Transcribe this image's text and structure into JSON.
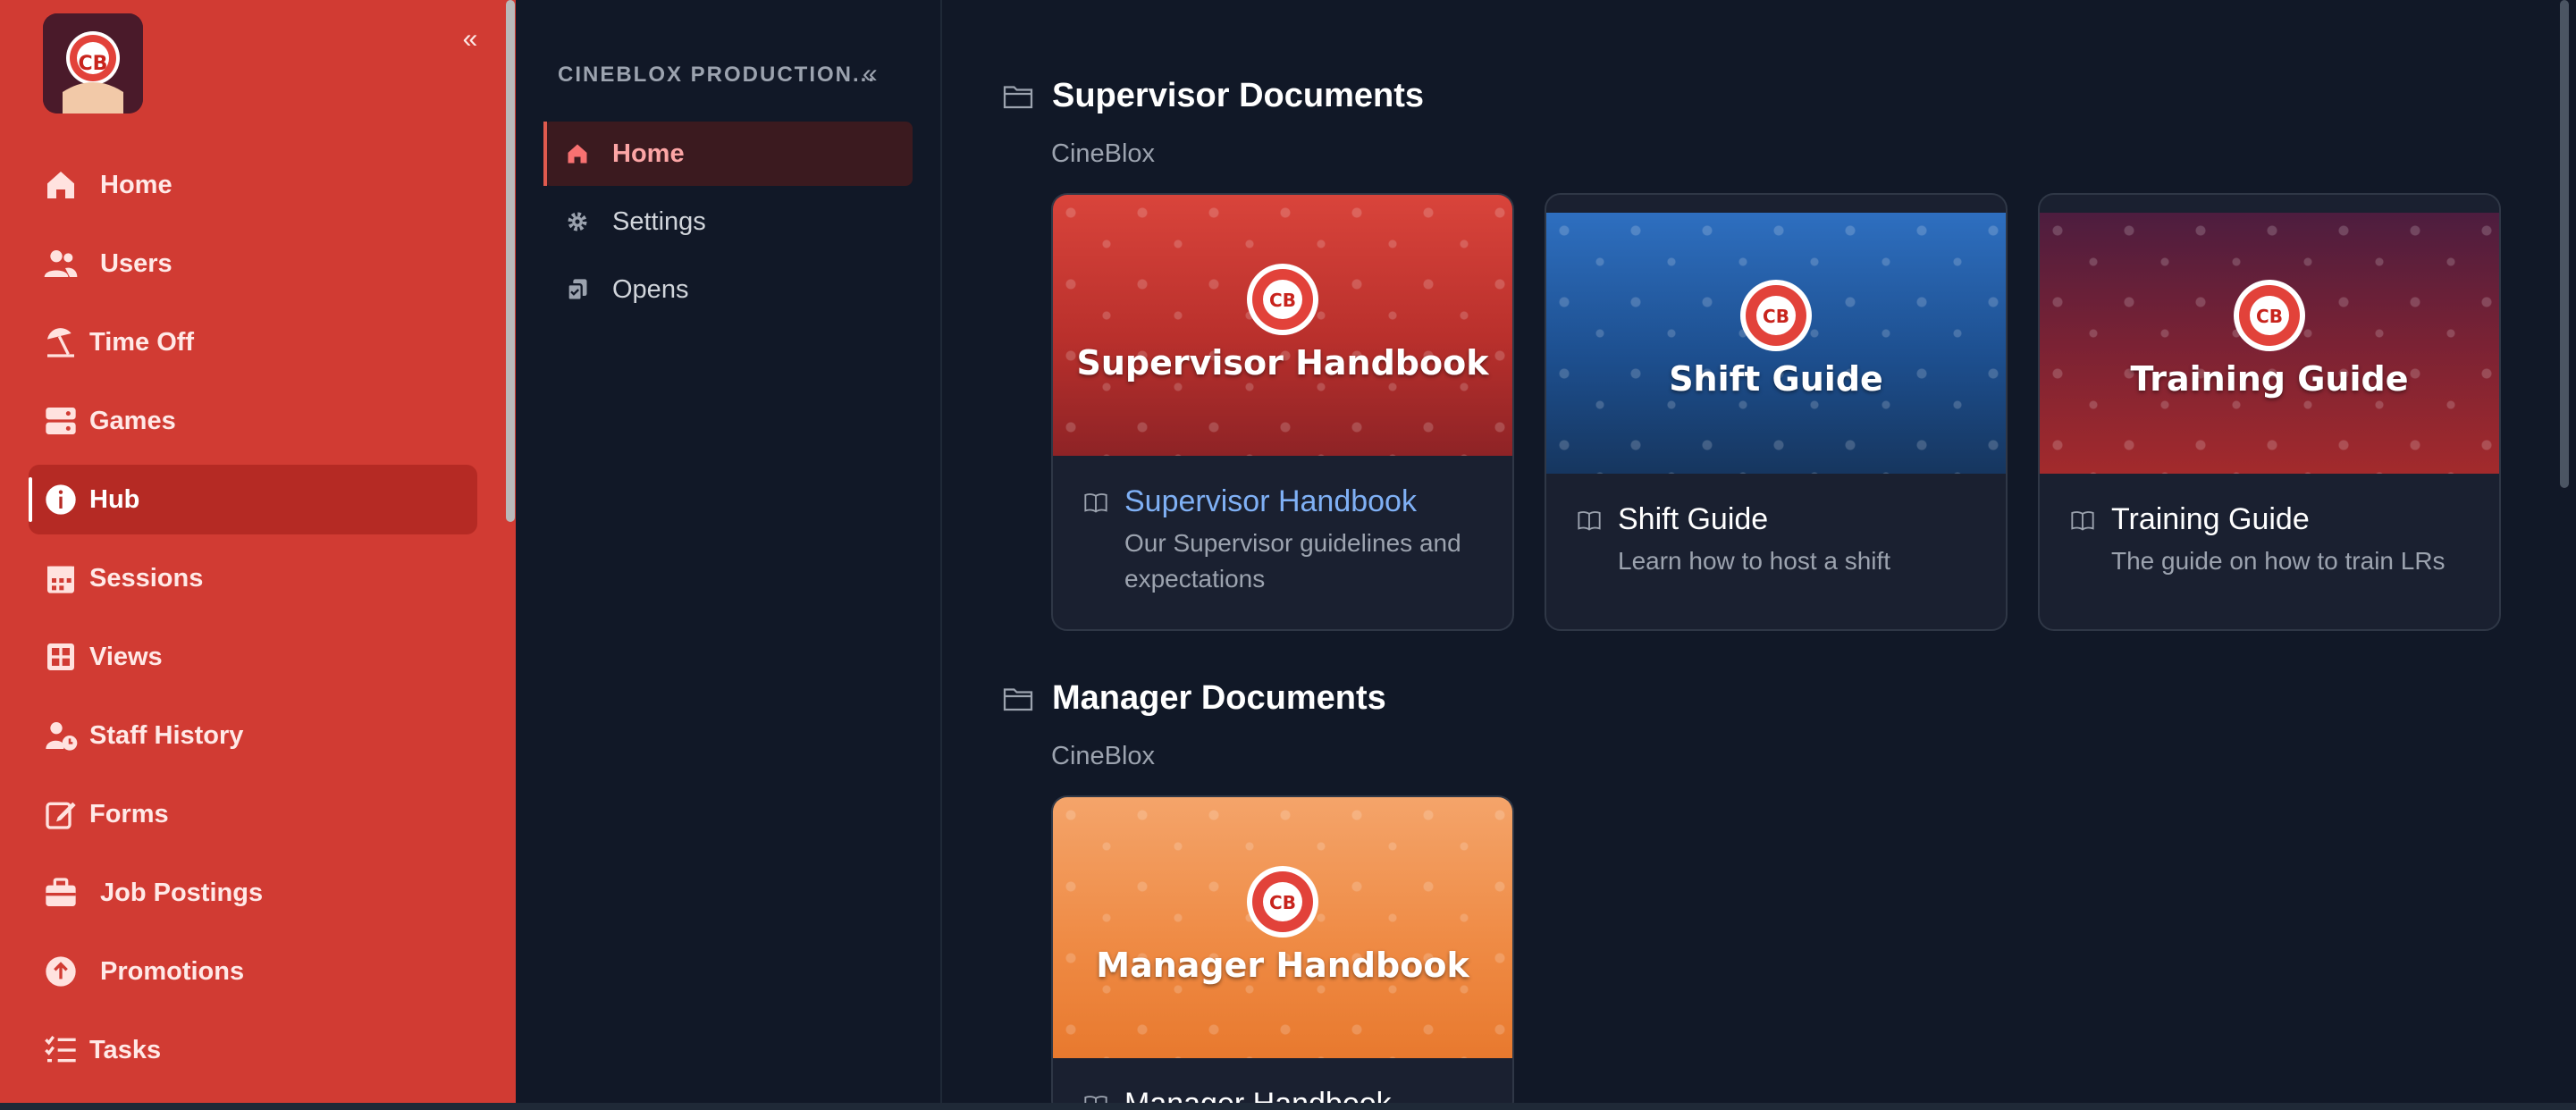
{
  "sidebar": {
    "logo_text": "CB",
    "collapse_glyph": "«",
    "items": [
      {
        "label": "Home",
        "icon": "home-icon"
      },
      {
        "label": "Users",
        "icon": "users-icon"
      },
      {
        "label": "Time Off",
        "icon": "umbrella-beach-icon"
      },
      {
        "label": "Games",
        "icon": "server-icon"
      },
      {
        "label": "Hub",
        "icon": "info-circle-icon",
        "active": true
      },
      {
        "label": "Sessions",
        "icon": "calendar-icon"
      },
      {
        "label": "Views",
        "icon": "table-grid-icon"
      },
      {
        "label": "Staff History",
        "icon": "user-clock-icon"
      },
      {
        "label": "Forms",
        "icon": "pen-square-icon"
      },
      {
        "label": "Job Postings",
        "icon": "briefcase-icon"
      },
      {
        "label": "Promotions",
        "icon": "arrow-up-circle-icon"
      },
      {
        "label": "Tasks",
        "icon": "list-check-icon"
      }
    ]
  },
  "panel": {
    "org_title": "CINEBLOX PRODUCTION...",
    "collapse_glyph": "«",
    "items": [
      {
        "label": "Home",
        "icon": "home-icon",
        "active": true
      },
      {
        "label": "Settings",
        "icon": "gear-icon"
      },
      {
        "label": "Opens",
        "icon": "documents-icon"
      }
    ]
  },
  "sections": [
    {
      "title": "Supervisor Documents",
      "subtitle": "CineBlox",
      "cards": [
        {
          "banner_title": "Supervisor Handbook",
          "title": "Supervisor Handbook",
          "description": "Our Supervisor guidelines and expectations",
          "banner_color": "#c9322c"
        },
        {
          "banner_title": "Shift Guide",
          "title": "Shift Guide",
          "description": "Learn how to host a shift",
          "banner_color": "#1f5fa8"
        },
        {
          "banner_title": "Training Guide",
          "title": "Training Guide",
          "description": "The guide on how to train LRs",
          "banner_color": "#6b2138"
        }
      ]
    },
    {
      "title": "Manager Documents",
      "subtitle": "CineBlox",
      "cards": [
        {
          "banner_title": "Manager Handbook",
          "title": "Manager Handbook",
          "description": "",
          "banner_color": "#ee8a45"
        }
      ]
    }
  ],
  "colors": {
    "sidebar_bg": "#d13b33",
    "page_bg": "#111827",
    "accent_link": "#7fb0f5"
  }
}
